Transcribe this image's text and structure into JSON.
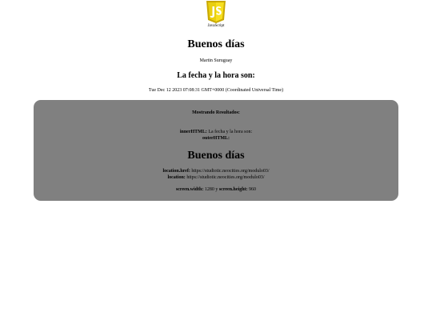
{
  "header": {
    "logo_caption": "JavaScript",
    "greeting": "Buenos días",
    "author": "Martin Suruguay",
    "datetime_heading": "La fecha y la hora son:",
    "datetime_value": "Tue Dec 12 2023 07:08:31 GMT+0000 (Coordinated Universal Time)"
  },
  "results": {
    "title": "Mostrando Resultados:",
    "innerHTML_label": "innerHTML:",
    "innerHTML_value": "La fecha y la hora son:",
    "outerHTML_label": "outerHTML:",
    "greeting": "Buenos días",
    "location_href_label": "location.href:",
    "location_href_value": "https://studiotic.neocities.org/modulo03/",
    "location_label": "location:",
    "location_value": "https://studiotic.neocities.org/modulo03/",
    "screen_width_label": "screen.width:",
    "screen_width_value": "1280",
    "screen_joiner": "y",
    "screen_height_label": "screen.height:",
    "screen_height_value": "960"
  },
  "colors": {
    "logo_yellow": "#f7df1e",
    "logo_dark": "#c9a800",
    "results_background": "#808080"
  },
  "icons": {
    "logo": "javascript-shield-logo"
  }
}
